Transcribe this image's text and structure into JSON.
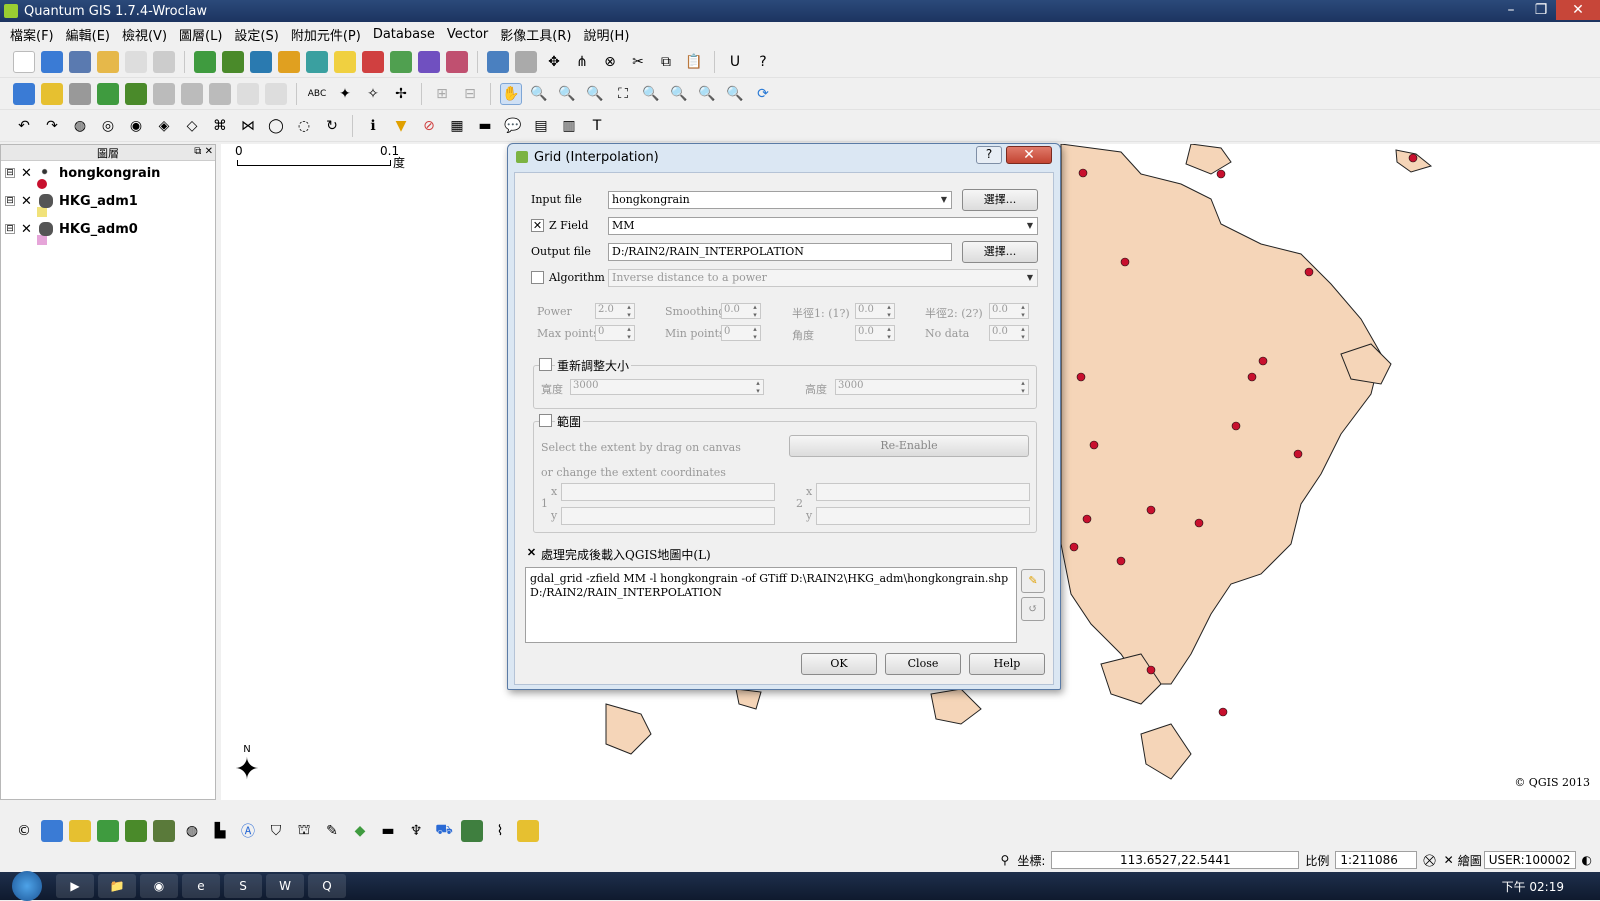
{
  "window": {
    "title": "Quantum GIS 1.7.4-Wroclaw",
    "minimize": "–",
    "restore": "❐",
    "close": "✕"
  },
  "menu": [
    "檔案(F)",
    "編輯(E)",
    "檢視(V)",
    "圖層(L)",
    "設定(S)",
    "附加元件(P)",
    "Database",
    "Vector",
    "影像工具(R)",
    "說明(H)"
  ],
  "layers_panel": {
    "title": "圖層",
    "items": [
      {
        "name": "hongkongrain",
        "checked": "✕",
        "expand": "⊟",
        "symbol_color": "#c8102e"
      },
      {
        "name": "HKG_adm1",
        "checked": "✕",
        "expand": "⊟",
        "symbol_color": "#f1e27a"
      },
      {
        "name": "HKG_adm0",
        "checked": "✕",
        "expand": "⊟",
        "symbol_color": "#e6a5d9"
      }
    ]
  },
  "map": {
    "scale_start": "0",
    "scale_end": "0.1",
    "scale_unit": "度",
    "north": "N",
    "copyright": "© QGIS 2013",
    "land_color": "#f5d5b8",
    "point_color": "#c8102e"
  },
  "dialog": {
    "title": "Grid (Interpolation)",
    "help_btn": "?",
    "close_btn": "✕",
    "input_file_label": "Input file",
    "input_file_value": "hongkongrain",
    "browse1": "選擇...",
    "zfield_label": "Z Field",
    "zfield_checked": "✕",
    "zfield_value": "MM",
    "output_file_label": "Output file",
    "output_file_value": "D:/RAIN2/RAIN_INTERPOLATION",
    "browse2": "選擇...",
    "algorithm_label": "Algorithm",
    "algorithm_value": "Inverse distance to a power",
    "params": {
      "power_label": "Power",
      "power_value": "2.0",
      "smoothing_label": "Smoothing",
      "smoothing_value": "0.0",
      "radius1_label": "半徑1: (1?)",
      "radius1_value": "0.0",
      "radius2_label": "半徑2: (2?)",
      "radius2_value": "0.0",
      "maxpoints_label": "Max points",
      "maxpoints_value": "0",
      "minpoints_label": "Min points",
      "minpoints_value": "0",
      "angle_label": "角度",
      "angle_value": "0.0",
      "nodata_label": "No data",
      "nodata_value": "0.0"
    },
    "resize_label": "重新調整大小",
    "width_label": "寬度",
    "width_value": "3000",
    "height_label": "高度",
    "height_value": "3000",
    "extent_label": "範圍",
    "extent_hint1": "Select the extent by drag on canvas",
    "extent_hint2": "or change the extent coordinates",
    "reenable": "Re-Enable",
    "x_label": "x",
    "y_label": "y",
    "pt1": "1",
    "pt2": "2",
    "load_label": "處理完成後載入QGIS地圖中(L)",
    "load_checked": "✕",
    "command": "gdal_grid -zfield MM -l hongkongrain -of GTiff D:\\RAIN2\\HKG_adm\\hongkongrain.shp\nD:/RAIN2/RAIN_INTERPOLATION",
    "edit_icon": "✎",
    "reset_icon": "↺",
    "ok": "OK",
    "close": "Close",
    "help": "Help"
  },
  "statusbar": {
    "coord_label": "坐標:",
    "coord_value": "113.6527,22.5441",
    "scale_label": "比例",
    "scale_value": "1:211086",
    "render_label": "繪圖",
    "render_checked": "✕",
    "crs": "USER:100002"
  },
  "taskbar": {
    "apps": [
      "▶",
      "📁",
      "◉",
      "e",
      "S",
      "W",
      "Q"
    ],
    "clock": "下午 02:19"
  }
}
